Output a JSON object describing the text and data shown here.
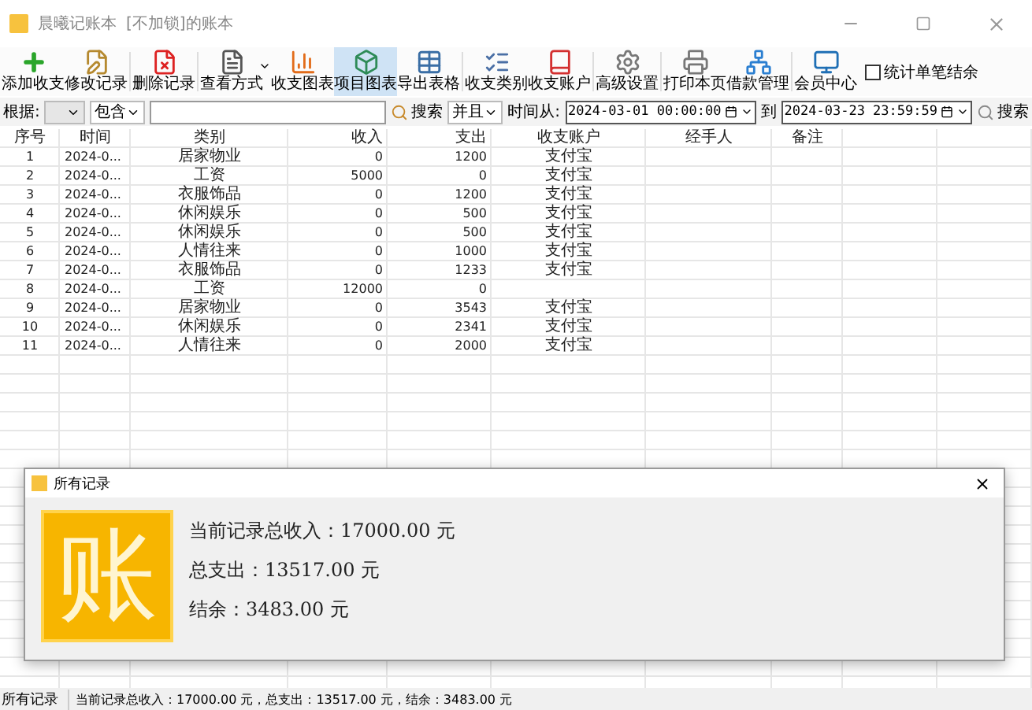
{
  "window": {
    "title": "晨曦记账本",
    "subtitle": "[不加锁]的账本"
  },
  "toolbar": [
    {
      "label": "添加收支",
      "selected": false
    },
    {
      "label": "修改记录",
      "selected": false
    },
    {
      "label": "删除记录",
      "selected": false
    },
    {
      "label": "查看方式",
      "selected": false
    },
    {
      "label": "收支图表",
      "selected": false
    },
    {
      "label": "项目图表",
      "selected": true
    },
    {
      "label": "导出表格",
      "selected": false
    },
    {
      "label": "收支类别",
      "selected": false
    },
    {
      "label": "收支账户",
      "selected": false
    },
    {
      "label": "高级设置",
      "selected": false
    },
    {
      "label": "打印本页",
      "selected": false
    },
    {
      "label": "借款管理",
      "selected": false
    },
    {
      "label": "会员中心",
      "selected": false
    }
  ],
  "toolbar_checkbox": {
    "label": "统计单笔结余",
    "checked": false
  },
  "filter": {
    "by_label": "根据:",
    "match_value": "包含",
    "search_button": "搜索",
    "logic_value": "并且",
    "time_from_label": "时间从:",
    "time_from": "2024-03-01 00:00:00",
    "time_to_label": "到",
    "time_to": "2024-03-23 23:59:59",
    "search_button_2": "搜索"
  },
  "table": {
    "columns": [
      "序号",
      "时间",
      "类别",
      "收入",
      "支出",
      "收支账户",
      "经手人",
      "备注"
    ],
    "rows": [
      [
        "1",
        "2024-0...",
        "居家物业",
        "0",
        "1200",
        "支付宝"
      ],
      [
        "2",
        "2024-0...",
        "工资",
        "5000",
        "0",
        "支付宝"
      ],
      [
        "3",
        "2024-0...",
        "衣服饰品",
        "0",
        "1200",
        "支付宝"
      ],
      [
        "4",
        "2024-0...",
        "休闲娱乐",
        "0",
        "500",
        "支付宝"
      ],
      [
        "5",
        "2024-0...",
        "休闲娱乐",
        "0",
        "500",
        "支付宝"
      ],
      [
        "6",
        "2024-0...",
        "人情往来",
        "0",
        "1000",
        "支付宝"
      ],
      [
        "7",
        "2024-0...",
        "衣服饰品",
        "0",
        "1233",
        "支付宝"
      ],
      [
        "8",
        "2024-0...",
        "工资",
        "12000",
        "0",
        ""
      ],
      [
        "9",
        "2024-0...",
        "居家物业",
        "0",
        "3543",
        "支付宝"
      ],
      [
        "10",
        "2024-0...",
        "休闲娱乐",
        "0",
        "2341",
        "支付宝"
      ],
      [
        "11",
        "2024-0...",
        "人情往来",
        "0",
        "2000",
        "支付宝"
      ]
    ]
  },
  "dialog": {
    "title": "所有记录",
    "logo": "账",
    "lines": [
      "当前记录总收入：17000.00 元",
      "总支出：13517.00 元",
      "结余：3483.00 元"
    ]
  },
  "status_bar": {
    "label": "所有记录",
    "summary": "当前记录总收入：17000.00 元，总支出：13517.00 元，结余：3483.00 元"
  }
}
